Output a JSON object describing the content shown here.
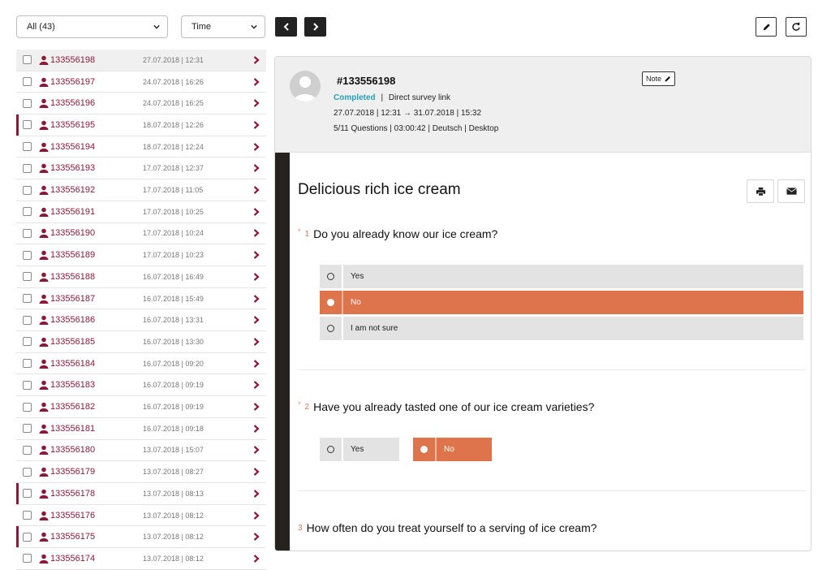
{
  "filters": {
    "scope_value": "All (43)",
    "sort_value": "Time"
  },
  "toolbar": {
    "prev_icon": "chevron-left-icon",
    "next_icon": "chevron-right-icon",
    "edit_icon": "pencil-icon",
    "reset_icon": "refresh-icon"
  },
  "list": [
    {
      "id": "133556198",
      "date": "27.07.2018 | 12:31",
      "selected": true,
      "marked": false
    },
    {
      "id": "133556197",
      "date": "24.07.2018 | 16:26",
      "selected": false,
      "marked": false
    },
    {
      "id": "133556196",
      "date": "24.07.2018 | 16:25",
      "selected": false,
      "marked": false
    },
    {
      "id": "133556195",
      "date": "18.07.2018 | 12:26",
      "selected": false,
      "marked": true
    },
    {
      "id": "133556194",
      "date": "18.07.2018 | 12:24",
      "selected": false,
      "marked": false
    },
    {
      "id": "133556193",
      "date": "17.07.2018 | 12:37",
      "selected": false,
      "marked": false
    },
    {
      "id": "133556192",
      "date": "17.07.2018 | 11:05",
      "selected": false,
      "marked": false
    },
    {
      "id": "133556191",
      "date": "17.07.2018 | 10:25",
      "selected": false,
      "marked": false
    },
    {
      "id": "133556190",
      "date": "17.07.2018 | 10:24",
      "selected": false,
      "marked": false
    },
    {
      "id": "133556189",
      "date": "17.07.2018 | 10:23",
      "selected": false,
      "marked": false
    },
    {
      "id": "133556188",
      "date": "16.07.2018 | 16:49",
      "selected": false,
      "marked": false
    },
    {
      "id": "133556187",
      "date": "16.07.2018 | 15:49",
      "selected": false,
      "marked": false
    },
    {
      "id": "133556186",
      "date": "16.07.2018 | 13:31",
      "selected": false,
      "marked": false
    },
    {
      "id": "133556185",
      "date": "16.07.2018 | 13:30",
      "selected": false,
      "marked": false
    },
    {
      "id": "133556184",
      "date": "16.07.2018 | 09:20",
      "selected": false,
      "marked": false
    },
    {
      "id": "133556183",
      "date": "16.07.2018 | 09:19",
      "selected": false,
      "marked": false
    },
    {
      "id": "133556182",
      "date": "16.07.2018 | 09:19",
      "selected": false,
      "marked": false
    },
    {
      "id": "133556181",
      "date": "16.07.2018 | 09:18",
      "selected": false,
      "marked": false
    },
    {
      "id": "133556180",
      "date": "13.07.2018 | 15:07",
      "selected": false,
      "marked": false
    },
    {
      "id": "133556179",
      "date": "13.07.2018 | 08:27",
      "selected": false,
      "marked": false
    },
    {
      "id": "133556178",
      "date": "13.07.2018 | 08:13",
      "selected": false,
      "marked": true
    },
    {
      "id": "133556176",
      "date": "13.07.2018 | 08:12",
      "selected": false,
      "marked": false
    },
    {
      "id": "133556175",
      "date": "13.07.2018 | 08:12",
      "selected": false,
      "marked": true
    },
    {
      "id": "133556174",
      "date": "13.07.2018 | 08:12",
      "selected": false,
      "marked": false
    }
  ],
  "detail": {
    "id": "#133556198",
    "note_label": "Note",
    "status": "Completed",
    "status_sep": "|",
    "source": "Direct survey link",
    "time_range": "27.07.2018 | 12:31 → 31.07.2018 | 15:32",
    "summary": "5/11 Questions | 03:00:42 | Deutsch | Desktop",
    "survey_title": "Delicious rich ice cream",
    "print_icon": "printer-icon",
    "mail_icon": "envelope-icon",
    "questions": [
      {
        "required": "*",
        "num": "1",
        "text": "Do you already know our ice cream?",
        "options": [
          {
            "label": "Yes",
            "checked": false
          },
          {
            "label": "No",
            "checked": true
          },
          {
            "label": "I am not sure",
            "checked": false
          }
        ]
      },
      {
        "required": "*",
        "num": "2",
        "text": "Have you already tasted one of our ice cream varieties?",
        "options": [
          {
            "label": "Yes",
            "checked": false
          },
          {
            "label": "No",
            "checked": true
          }
        ]
      },
      {
        "required": "",
        "num": "3",
        "text": "How often do you treat yourself to a serving of ice cream?",
        "options": []
      }
    ]
  },
  "colors": {
    "accent": "#8b1a3a",
    "selected_option": "#dd744c",
    "status_completed": "#26a0b5",
    "sidebar_dark": "#262220"
  }
}
